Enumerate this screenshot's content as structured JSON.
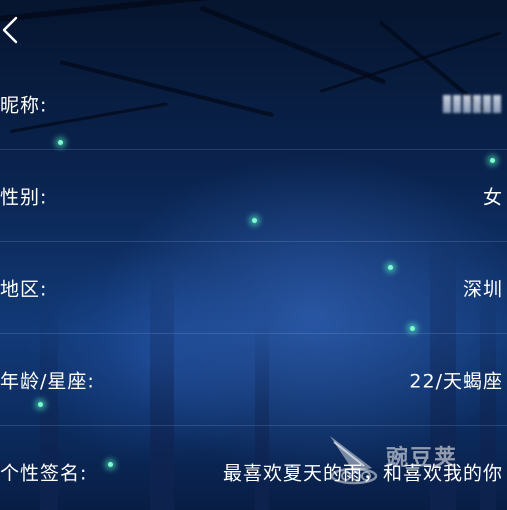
{
  "profile": {
    "rows": [
      {
        "label": "昵称:",
        "value": ""
      },
      {
        "label": "性别:",
        "value": "女"
      },
      {
        "label": "地区:",
        "value": "深圳"
      },
      {
        "label": "年龄/星座:",
        "value": "22/天蝎座"
      },
      {
        "label": "个性签名:",
        "value": "最喜欢夏天的雨，和喜欢我的你"
      }
    ]
  },
  "watermark": {
    "text": "豌豆荚"
  },
  "icons": {
    "back": "chevron-left-icon",
    "watermark": "pea-logo-icon"
  },
  "colors": {
    "text": "#ffffff",
    "background": "#0a2450",
    "divider": "#8caadc"
  }
}
